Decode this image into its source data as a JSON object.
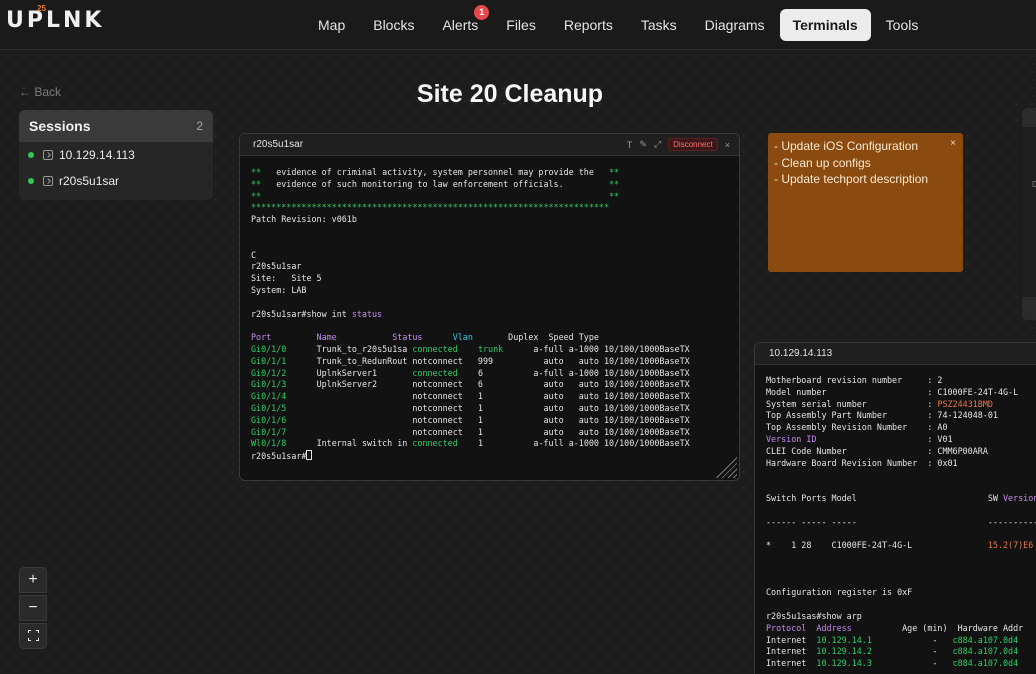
{
  "app": {
    "logo_sup": "25",
    "logo_text": "UPLNK"
  },
  "nav": {
    "items": [
      {
        "label": "Map"
      },
      {
        "label": "Blocks"
      },
      {
        "label": "Alerts",
        "badge": "1"
      },
      {
        "label": "Files"
      },
      {
        "label": "Reports"
      },
      {
        "label": "Tasks"
      },
      {
        "label": "Diagrams"
      },
      {
        "label": "Terminals",
        "active": true
      },
      {
        "label": "Tools"
      }
    ]
  },
  "back_label": "← Back",
  "page_title": "Site 20 Cleanup",
  "sessions": {
    "title": "Sessions",
    "count": "2",
    "items": [
      {
        "label": "10.129.14.113",
        "status": "connected"
      },
      {
        "label": "r20s5u1sar",
        "status": "connected"
      }
    ]
  },
  "terminal1": {
    "title": "r20s5u1sar",
    "actions": [
      "T",
      "✎",
      "⤢"
    ],
    "disconnect_label": "Disconnect",
    "close": "×",
    "lines": [
      [
        [
          "g",
          "**"
        ],
        [
          "",
          "   evidence of criminal activity, system personnel may provide the   "
        ],
        [
          "g",
          "**"
        ]
      ],
      [
        [
          "g",
          "**"
        ],
        [
          "",
          "   evidence of such monitoring to law enforcement officials.         "
        ],
        [
          "g",
          "**"
        ]
      ],
      [
        [
          "g",
          "**                                                                     **"
        ]
      ],
      [
        [
          "g",
          "***********************************************************************"
        ]
      ],
      [
        [
          "",
          "Patch Revision: v061b"
        ]
      ],
      [
        [
          "",
          ""
        ]
      ],
      [
        [
          "",
          ""
        ]
      ],
      [
        [
          "",
          "C"
        ]
      ],
      [
        [
          "",
          "r20s5u1sar"
        ]
      ],
      [
        [
          "",
          "Site:   Site 5"
        ]
      ],
      [
        [
          "",
          "System: LAB"
        ]
      ],
      [
        [
          "",
          ""
        ]
      ],
      [
        [
          "",
          "r20s5u1sar#show int "
        ],
        [
          "p",
          "status"
        ]
      ],
      [
        [
          "",
          ""
        ]
      ],
      [
        [
          "p",
          "Port         Name           "
        ],
        [
          "p",
          "Status      "
        ],
        [
          "c",
          "Vlan       "
        ],
        [
          "",
          "Duplex  Speed Type"
        ]
      ],
      [
        [
          "g",
          "Gi0/1/0      "
        ],
        [
          "",
          "Trunk_to_r20s5u1sa "
        ],
        [
          "g",
          "connected    "
        ],
        [
          "g",
          "trunk      "
        ],
        [
          "",
          "a-full a-1000 10/100/1000BaseTX"
        ]
      ],
      [
        [
          "g",
          "Gi0/1/1      "
        ],
        [
          "",
          "Trunk_to_RedunRout notconnect   999          auto   auto 10/100/1000BaseTX"
        ]
      ],
      [
        [
          "g",
          "Gi0/1/2      "
        ],
        [
          "",
          "UplnkServer1       "
        ],
        [
          "g",
          "connected    "
        ],
        [
          "",
          "6          a-full a-1000 10/100/1000BaseTX"
        ]
      ],
      [
        [
          "g",
          "Gi0/1/3      "
        ],
        [
          "",
          "UplnkServer2       notconnect   6            auto   auto 10/100/1000BaseTX"
        ]
      ],
      [
        [
          "g",
          "Gi0/1/4      "
        ],
        [
          "",
          "                   notconnect   1            auto   auto 10/100/1000BaseTX"
        ]
      ],
      [
        [
          "g",
          "Gi0/1/5      "
        ],
        [
          "",
          "                   notconnect   1            auto   auto 10/100/1000BaseTX"
        ]
      ],
      [
        [
          "g",
          "Gi0/1/6      "
        ],
        [
          "",
          "                   notconnect   1            auto   auto 10/100/1000BaseTX"
        ]
      ],
      [
        [
          "g",
          "Gi0/1/7      "
        ],
        [
          "",
          "                   notconnect   1            auto   auto 10/100/1000BaseTX"
        ]
      ],
      [
        [
          "g",
          "Wl0/1/8      "
        ],
        [
          "",
          "Internal switch in "
        ],
        [
          "g",
          "connected    "
        ],
        [
          "",
          "1          a-full a-1000 10/100/1000BaseTX"
        ]
      ]
    ],
    "prompt": "r20s5u1sar#"
  },
  "terminal2": {
    "title": "10.129.14.113",
    "lines": [
      [
        [
          "",
          "Motherboard revision number     : 2"
        ]
      ],
      [
        [
          "",
          "Model number                    : C1000FE-24T-4G-L"
        ]
      ],
      [
        [
          "",
          "System serial number            : "
        ],
        [
          "o",
          "PSZ24431BMD"
        ]
      ],
      [
        [
          "",
          "Top Assembly Part Number        : 74-124048-01"
        ]
      ],
      [
        [
          "",
          "Top Assembly Revision Number    : A0"
        ]
      ],
      [
        [
          "p",
          "Version ID"
        ],
        [
          "",
          "                      : V01"
        ]
      ],
      [
        [
          "",
          "CLEI Code Number                : CMM6P00ARA"
        ]
      ],
      [
        [
          "",
          "Hardware Board Revision Number  : 0x01"
        ]
      ],
      [
        [
          "",
          ""
        ]
      ],
      [
        [
          "",
          ""
        ]
      ],
      [
        [
          "",
          "Switch Ports Model                          SW "
        ],
        [
          "p",
          "Version"
        ]
      ],
      [
        [
          "",
          ""
        ]
      ],
      [
        [
          "",
          "------ ----- -----                          ----------"
        ]
      ],
      [
        [
          "",
          ""
        ]
      ],
      [
        [
          "",
          "*    1 28    C1000FE-24T-4G-L               "
        ],
        [
          "o",
          "15.2(7)E6"
        ]
      ],
      [
        [
          "",
          ""
        ]
      ],
      [
        [
          "",
          ""
        ]
      ],
      [
        [
          "",
          ""
        ]
      ],
      [
        [
          "",
          "Configuration register is 0xF"
        ]
      ],
      [
        [
          "",
          ""
        ]
      ],
      [
        [
          "",
          "r20s5u1sas#show arp"
        ]
      ],
      [
        [
          "p",
          "Protocol  Address"
        ],
        [
          "",
          "          Age (min)  Hardware Addr"
        ]
      ],
      [
        [
          "",
          "Internet  "
        ],
        [
          "g",
          "10.129.14.1"
        ],
        [
          "",
          "            -   "
        ],
        [
          "g",
          "c884.a107.0d4"
        ]
      ],
      [
        [
          "",
          "Internet  "
        ],
        [
          "g",
          "10.129.14.2"
        ],
        [
          "",
          "            -   "
        ],
        [
          "g",
          "c884.a107.0d4"
        ]
      ],
      [
        [
          "",
          "Internet  "
        ],
        [
          "g",
          "10.129.14.3"
        ],
        [
          "",
          "            -   "
        ],
        [
          "g",
          "c884.a107.0d4"
        ]
      ]
    ]
  },
  "sticky_note": {
    "lines": [
      "- Update iOS Configuration",
      "- Clean up configs",
      "- Update techport description"
    ],
    "close": "×",
    "color": "#8a4a10"
  },
  "edge_panel_text": "D",
  "zoom": {
    "in": "+",
    "out": "−"
  },
  "colors": {
    "accent_orange": "#e87a2a",
    "connected_green": "#34c759",
    "badge_red": "#e5484d"
  }
}
